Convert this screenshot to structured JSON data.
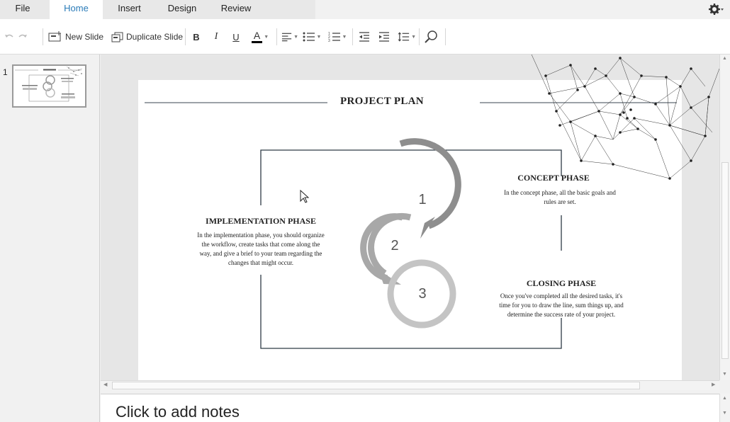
{
  "menu": {
    "tabs": [
      {
        "label": "File"
      },
      {
        "label": "Home"
      },
      {
        "label": "Insert"
      },
      {
        "label": "Design"
      },
      {
        "label": "Review"
      }
    ],
    "active_tab": "Home"
  },
  "toolbar": {
    "new_slide_label": "New Slide",
    "duplicate_slide_label": "Duplicate Slide",
    "bold_label": "B",
    "italic_label": "I",
    "underline_label": "U",
    "font_color_label": "A",
    "font_color": "#000000"
  },
  "slide_panel": {
    "slide_number": "1"
  },
  "slide": {
    "title": "PROJECT PLAN",
    "cycle_numbers": [
      "1",
      "2",
      "3"
    ],
    "phases": {
      "concept": {
        "heading": "CONCEPT PHASE",
        "lines": [
          "In the concept phase, all the basic goals and",
          "rules are set."
        ]
      },
      "implementation": {
        "heading": "IMPLEMENTATION PHASE",
        "lines": [
          "In the implementation phase, you should organize",
          "the workflow, create tasks that come along the",
          "way, and give a brief to your team regarding the",
          "changes that might occur."
        ]
      },
      "closing": {
        "heading": "CLOSING PHASE",
        "lines": [
          "Once you've completed all the desired tasks, it's",
          "time for you to draw the line, sum things up, and",
          "determine the success rate of your project."
        ]
      }
    }
  },
  "notes": {
    "placeholder": "Click to add notes"
  },
  "colors": {
    "accent": "#2a7bb8",
    "frame": "#2e3a45"
  }
}
